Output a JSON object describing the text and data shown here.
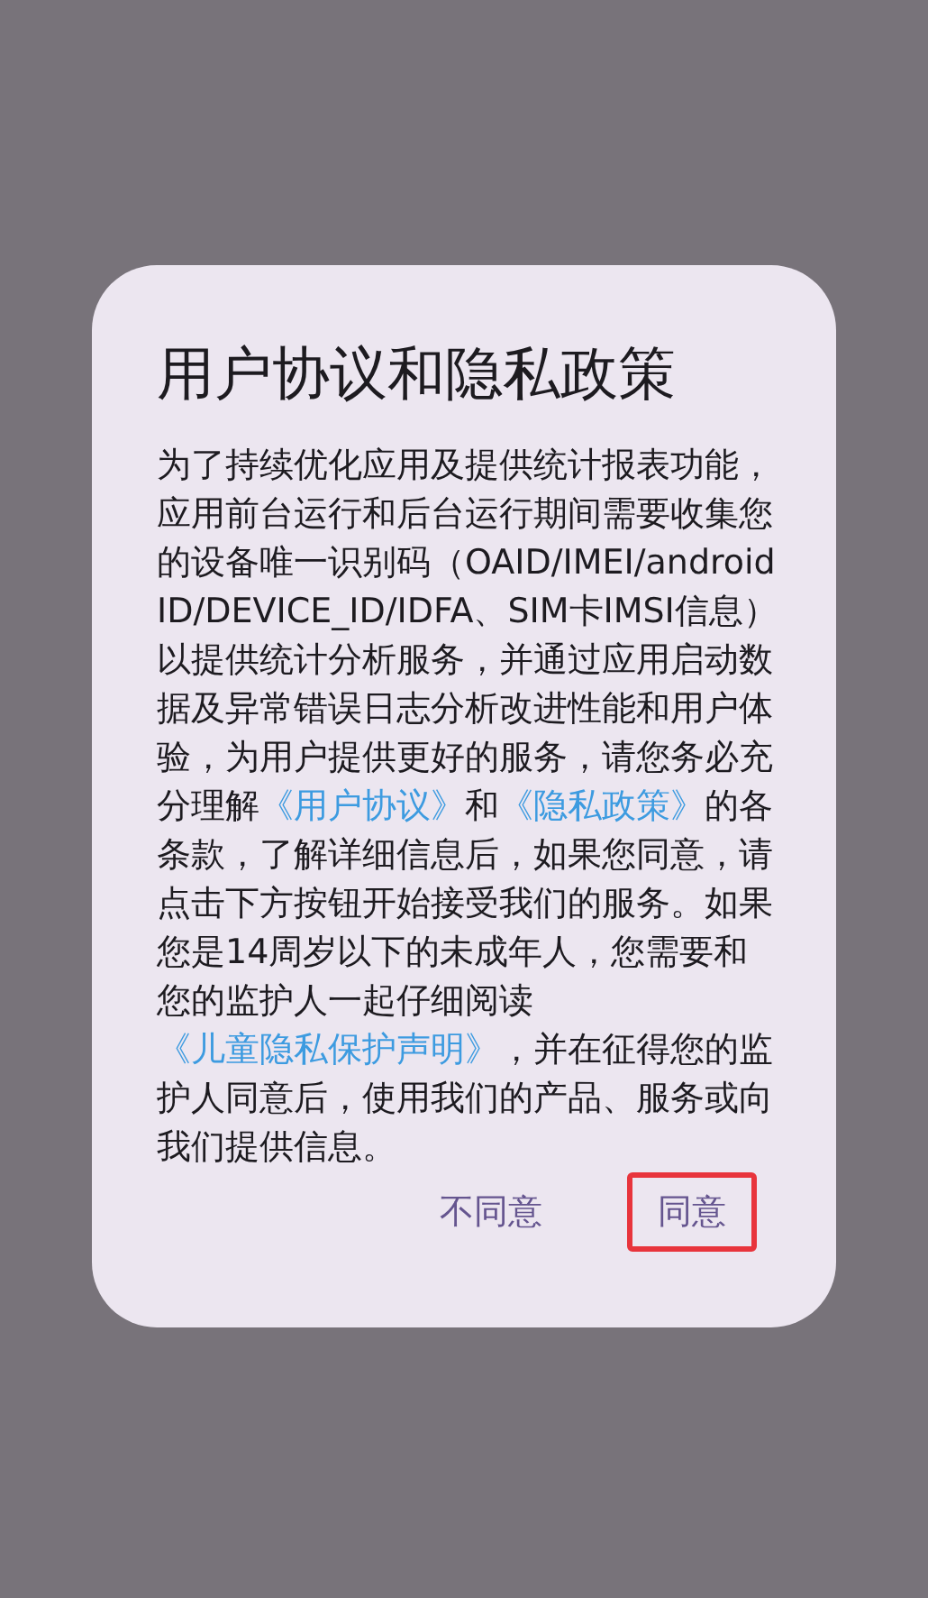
{
  "dialog": {
    "title": "用户协议和隐私政策",
    "body": [
      {
        "kind": "text",
        "text": "为了持续优化应用及提供统计报表功能，应用前台运行和后台运行期间需要收集您的设备唯一识别码（OAID/IMEI/android ID/DEVICE_ID/IDFA、SIM卡IMSI信息）以提供统计分析服务，并通过应用启动数据及异常错误日志分析改进性能和用户体验，为用户提供更好的服务，请您务必充分理解"
      },
      {
        "kind": "link",
        "text": "《用户协议》"
      },
      {
        "kind": "text",
        "text": "和"
      },
      {
        "kind": "link",
        "text": "《隐私政策》"
      },
      {
        "kind": "text",
        "text": "的各条款，了解详细信息后，如果您同意，请点击下方按钮开始接受我们的服务。如果您是14周岁以下的未成年人，您需要和您的监护人一起仔细阅读"
      },
      {
        "kind": "link",
        "text": "《儿童隐私保护声明》"
      },
      {
        "kind": "text",
        "text": "，并在征得您的监护人同意后，使用我们的产品、服务或向我们提供信息。"
      }
    ],
    "buttons": [
      {
        "label": "不同意",
        "highlighted": false
      },
      {
        "label": "同意",
        "highlighted": true
      }
    ]
  }
}
